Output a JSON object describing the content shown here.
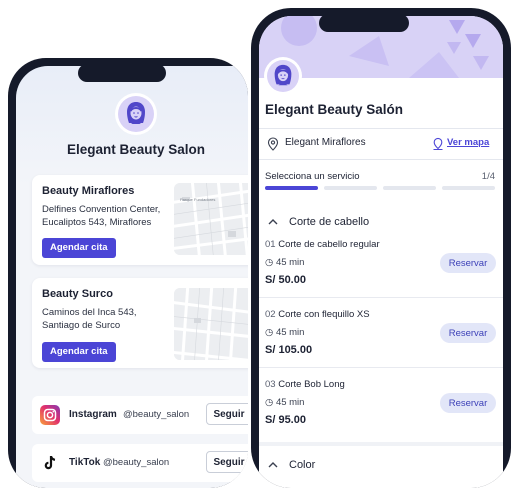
{
  "colors": {
    "accent": "#4b45d6",
    "avatar_bg": "#d9d2f7",
    "header_bg": "#d8d2f6",
    "phone_frame": "#151a2a"
  },
  "profile_screen": {
    "salon_name": "Elegant Beauty Salon",
    "locations": [
      {
        "title": "Beauty Miraflores",
        "address": "Delfines Convention Center, Eucaliptos 543, Miraflores",
        "button": "Agendar cita",
        "map_label": "Parque Fundadores"
      },
      {
        "title": "Beauty Surco",
        "address": "Caminos del Inca 543, Santiago de Surco",
        "button": "Agendar cita",
        "map_label": ""
      }
    ],
    "socials": [
      {
        "icon": "instagram-icon",
        "name": "Instagram",
        "handle": "@beauty_salon",
        "button": "Seguir"
      },
      {
        "icon": "tiktok-icon",
        "name": "TikTok",
        "handle": "@beauty_salon",
        "button": "Seguir"
      }
    ]
  },
  "booking_screen": {
    "salon_name": "Elegant Beauty Salón",
    "location": {
      "icon": "location-pin-icon",
      "name": "Elegant Miraflores",
      "map_link": "Ver mapa",
      "map_icon": "map-pin-icon"
    },
    "steps": {
      "label": "Selecciona un servicio",
      "counter": "1/4",
      "current": 1,
      "total": 4
    },
    "categories": [
      {
        "name": "Corte de cabello",
        "services": [
          {
            "number": "01",
            "name": "Corte de cabello regular",
            "duration": "45 min",
            "price": "S/ 50.00",
            "button": "Reservar"
          },
          {
            "number": "02",
            "name": "Corte con flequillo XS",
            "duration": "45 min",
            "price": "S/ 105.00",
            "button": "Reservar"
          },
          {
            "number": "03",
            "name": "Corte Bob Long",
            "duration": "45 min",
            "price": "S/ 95.00",
            "button": "Reservar"
          }
        ]
      },
      {
        "name": "Color",
        "services": []
      }
    ]
  }
}
